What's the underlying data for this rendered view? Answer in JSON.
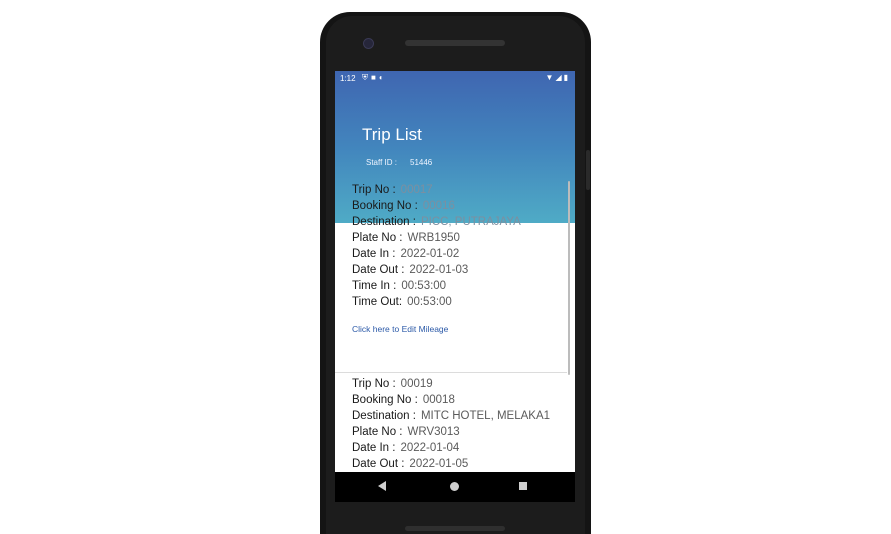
{
  "status_bar": {
    "time": "1:12",
    "left_icons": [
      "shield-icon",
      "sd-card-icon",
      "sync-icon"
    ],
    "right_icons": [
      "wifi-icon",
      "signal-icon",
      "battery-icon"
    ]
  },
  "header": {
    "title": "Trip List",
    "staff_label": "Staff ID :",
    "staff_id": "51446"
  },
  "labels": {
    "trip_no": "Trip No :",
    "booking_no": "Booking No :",
    "destination": "Destination :",
    "plate_no": "Plate No :",
    "date_in": "Date In :",
    "date_out": "Date Out :",
    "time_in": "Time In :",
    "time_out": "Time Out:",
    "edit_link": "Click here to Edit Mileage"
  },
  "trips": [
    {
      "trip_no": "00017",
      "booking_no": "00016",
      "destination": "PICC, PUTRAJAYA",
      "plate_no": "WRB1950",
      "date_in": "2022-01-02",
      "date_out": "2022-01-03",
      "time_in": "00:53:00",
      "time_out": "00:53:00"
    },
    {
      "trip_no": "00019",
      "booking_no": "00018",
      "destination": "MITC HOTEL, MELAKA1",
      "plate_no": "WRV3013",
      "date_in": "2022-01-04",
      "date_out": "2022-01-05"
    }
  ],
  "nav_bar": [
    "back-icon",
    "home-icon",
    "recents-icon"
  ]
}
